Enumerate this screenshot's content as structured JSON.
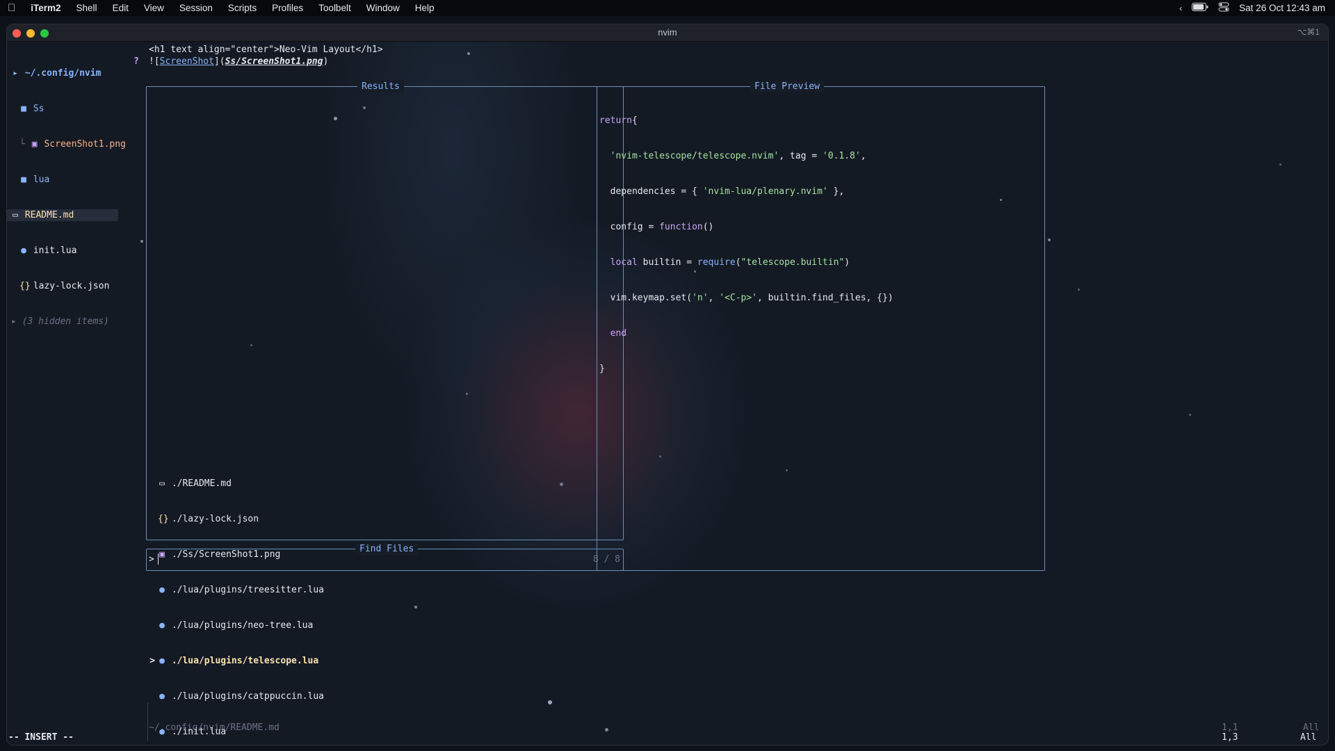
{
  "menubar": {
    "apple_icon": "apple-icon",
    "app_name": "iTerm2",
    "menus": [
      "Shell",
      "Edit",
      "View",
      "Session",
      "Scripts",
      "Profiles",
      "Toolbelt",
      "Window",
      "Help"
    ],
    "clock": "Sat 26 Oct  12:43 am"
  },
  "window": {
    "title": "nvim",
    "shortcut": "⌥⌘1"
  },
  "tree": {
    "root": "~/.config/nvim",
    "items": [
      {
        "label": "Ss",
        "icon": "folder-icon"
      },
      {
        "label": "ScreenShot1.png",
        "icon": "image-icon"
      },
      {
        "label": "lua",
        "icon": "folder-icon"
      },
      {
        "label": "README.md",
        "icon": "markdown-icon"
      },
      {
        "label": "init.lua",
        "icon": "lua-icon"
      },
      {
        "label": "lazy-lock.json",
        "icon": "json-icon"
      }
    ],
    "hidden": "(3 hidden items)"
  },
  "editor": {
    "line1": "<h1 text align=\"center\">Neo-Vim Layout</h1>",
    "line2_prefix": "![",
    "line2_link": "ScreenShot",
    "line2_mid": "](",
    "line2_path": "Ss/ScreenShot1.png",
    "line2_suffix": ")",
    "file_path": "~/.config/nvim/README.md"
  },
  "telescope": {
    "results_title": "Results",
    "preview_title": "File Preview",
    "prompt_title": "Find Files",
    "prompt_symbol": ">",
    "counter": "8 / 8",
    "selection_marker": ">",
    "results": [
      {
        "path": "./README.md",
        "icon": "markdown-icon"
      },
      {
        "path": "./lazy-lock.json",
        "icon": "json-icon"
      },
      {
        "path": "./Ss/ScreenShot1.png",
        "icon": "image-icon"
      },
      {
        "path": "./lua/plugins/treesitter.lua",
        "icon": "lua-icon"
      },
      {
        "path": "./lua/plugins/neo-tree.lua",
        "icon": "lua-icon"
      },
      {
        "path": "./lua/plugins/telescope.lua",
        "icon": "lua-icon",
        "selected": true
      },
      {
        "path": "./lua/plugins/catppuccin.lua",
        "icon": "lua-icon"
      },
      {
        "path": "./init.lua",
        "icon": "lua-icon"
      }
    ],
    "preview": {
      "l1_kw": "return",
      "l1_br": "{",
      "l2_str1": "'nvim-telescope/telescope.nvim'",
      "l2_mid": ", tag = ",
      "l2_str2": "'0.1.8'",
      "l2_end": ",",
      "l3_key": "dependencies",
      "l3_mid": " = { ",
      "l3_str": "'nvim-lua/plenary.nvim'",
      "l3_end": " },",
      "l4_key": "config",
      "l4_mid": " = ",
      "l4_fn": "function",
      "l4_end": "()",
      "l5_kw": "local",
      "l5_var": " builtin = ",
      "l5_fn": "require",
      "l5_open": "(",
      "l5_str": "\"telescope.builtin\"",
      "l5_close": ")",
      "l6_a": "vim.keymap.set(",
      "l6_s1": "'n'",
      "l6_c": ", ",
      "l6_s2": "'<C-p>'",
      "l6_b": ", builtin.find_files, {})",
      "l7": "end",
      "l8": "}"
    }
  },
  "statusline": {
    "mode": "-- INSERT --",
    "pos_dim": "1,1",
    "all_dim": "All",
    "pos": "1,3",
    "all": "All"
  },
  "colors": {
    "accent": "#89b4fa",
    "border": "#6e8fb8",
    "string": "#a6e3a1",
    "keyword": "#cba6f7",
    "function": "#89b4fa"
  }
}
